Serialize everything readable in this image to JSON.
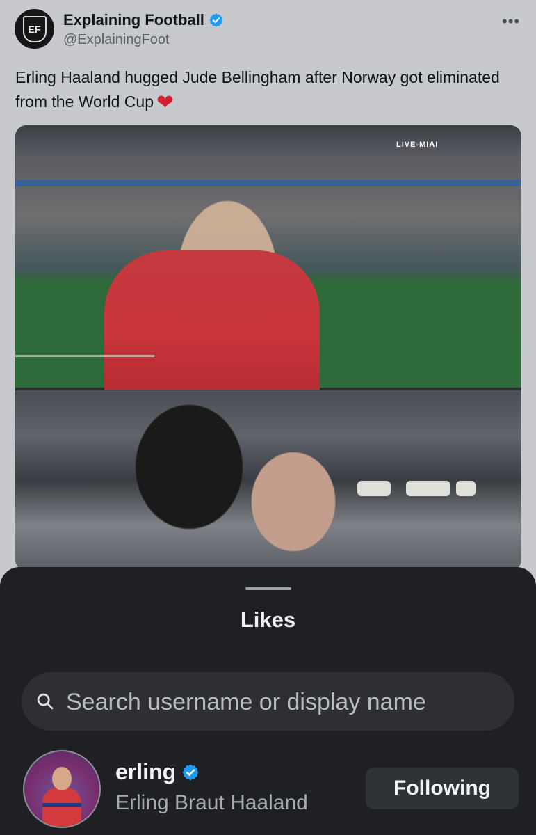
{
  "tweet": {
    "author_name": "Explaining Football",
    "author_handle": "@ExplainingFoot",
    "avatar_initials": "EF",
    "more_label": "•••",
    "text": "Erling Haaland hugged Jude Bellingham after Norway got eliminated from the World Cup",
    "emoji": "❤",
    "scoreboard_overlay": "LIVE-MIAI"
  },
  "likes_sheet": {
    "title": "Likes",
    "search": {
      "placeholder": "Search username or display name",
      "value": ""
    },
    "users": [
      {
        "username": "erling",
        "display_name": "Erling Braut Haaland",
        "verified": true,
        "follow_label": "Following"
      }
    ]
  },
  "colors": {
    "verified_blue": "#1d9bf0",
    "sheet_bg": "#1e2023",
    "heart_red": "#d0202f"
  },
  "icons": [
    "verified-badge-icon",
    "search-icon",
    "more-icon",
    "heart-emoji"
  ]
}
